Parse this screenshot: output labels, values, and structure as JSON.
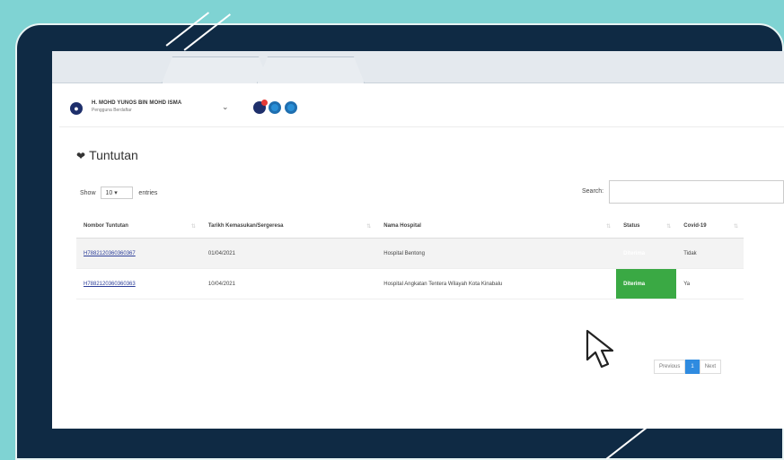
{
  "colors": {
    "background": "#7fd3d3",
    "frame": "#0f2a44",
    "status_green": "#3aa944",
    "pager_active": "#2f8be0",
    "link": "#2c3e99"
  },
  "header": {
    "user_name": "H. MOHD YUNOS BIN MOHD ISMA",
    "user_role": "Pengguna Berdaftar",
    "avatar_icon": "user-circle-icon",
    "icons": [
      "notification-icon",
      "message-icon",
      "chat-icon"
    ]
  },
  "page": {
    "title": "Tuntutan",
    "title_icon": "heart-pulse-icon"
  },
  "table_controls": {
    "show_label": "Show",
    "entries_value": "10",
    "entries_label": "entries",
    "search_label": "Search:",
    "search_value": ""
  },
  "table": {
    "columns": [
      "Nombor Tuntutan",
      "Tarikh Kemasukan/Sergeresa",
      "Nama Hospital",
      "Status",
      "Covid-19"
    ],
    "rows": [
      {
        "nombor": "H7882120360360367",
        "tarikh": "01/04/2021",
        "hospital": "Hospital Bentong",
        "status": "Diterima",
        "covid": "Tidak"
      },
      {
        "nombor": "H7882120360360363",
        "tarikh": "10/04/2021",
        "hospital": "Hospital Angkatan Tentera Wilayah Kota Kinabalu",
        "status": "Diterima",
        "covid": "Ya"
      }
    ]
  },
  "pagination": {
    "previous": "Previous",
    "current": "1",
    "next": "Next"
  }
}
